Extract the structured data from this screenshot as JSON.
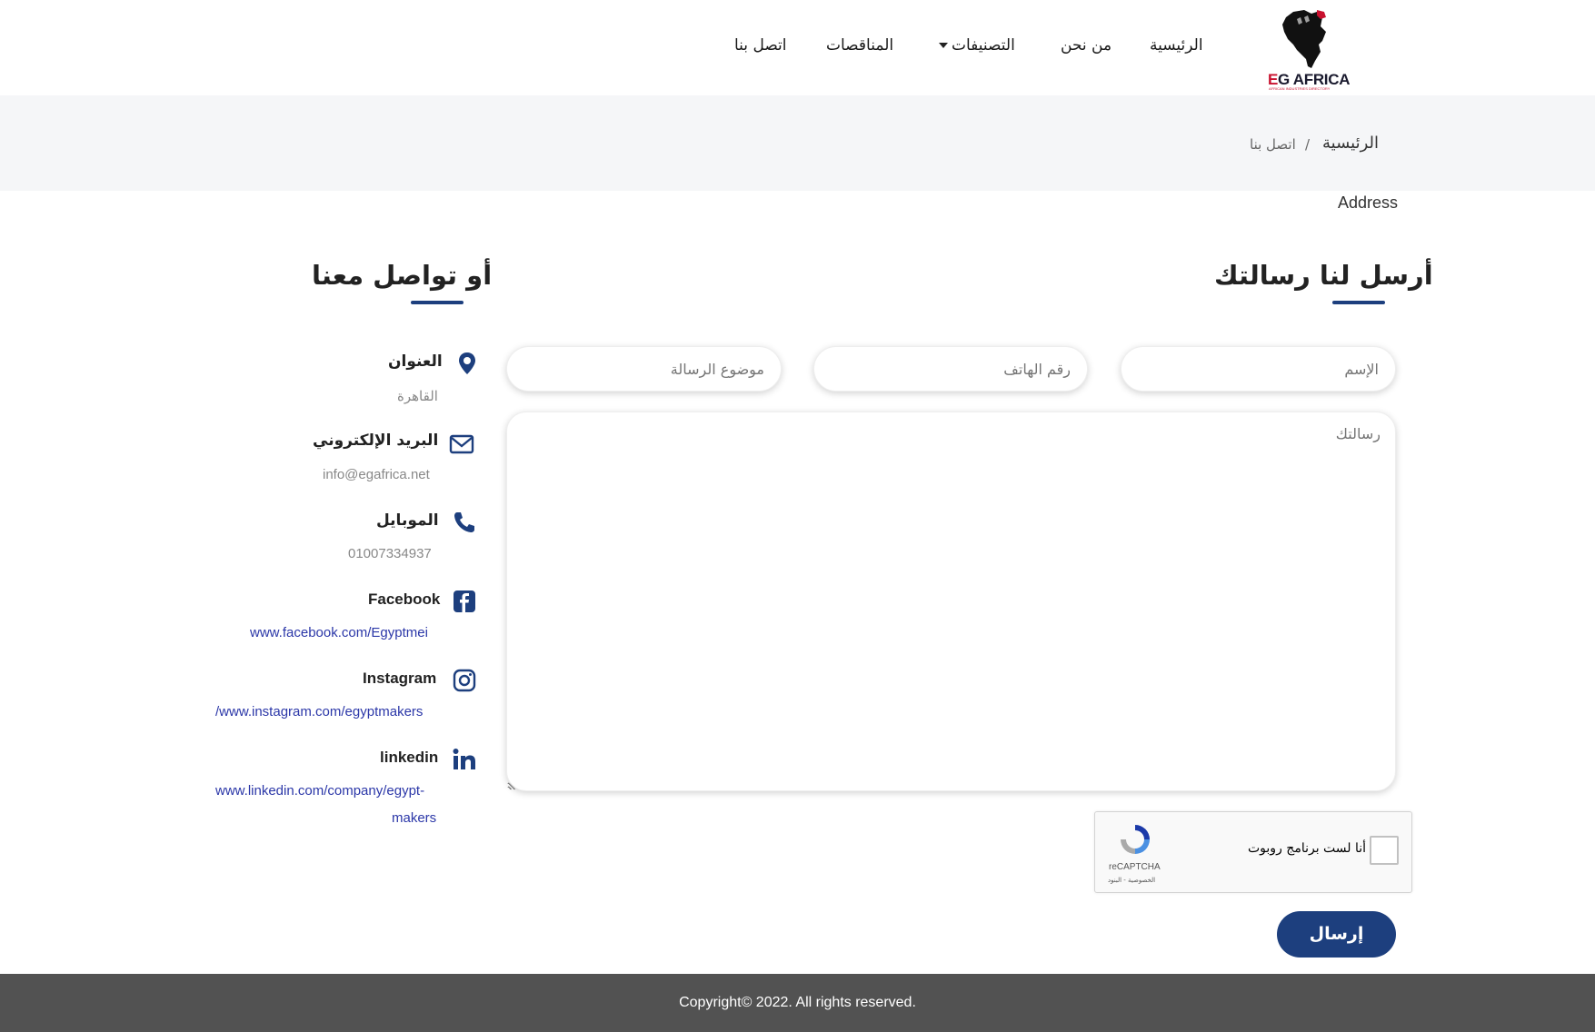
{
  "header": {
    "logo_text_e": "E",
    "logo_text_rest": "G AFRICA",
    "logo_sub": "AFRICAN INDUSTRIES DIRECTORY",
    "nav": {
      "home": "الرئيسية",
      "about": "من نحن",
      "categories": "التصنيفات",
      "tenders": "المناقصات",
      "contact": "اتصل بنا"
    }
  },
  "breadcrumb": {
    "home": "الرئيسية",
    "separator": "/",
    "current": "اتصل بنا"
  },
  "address_label": "Address",
  "form": {
    "title": "أرسل لنا رسالتك",
    "name_placeholder": "الإسم",
    "phone_placeholder": "رقم الهاتف",
    "subject_placeholder": "موضوع الرسالة",
    "message_placeholder": "رسالتك",
    "captcha": {
      "label": "أنا لست برنامج روبوت",
      "brand": "reCAPTCHA",
      "links": "الخصوصية - البنود"
    },
    "submit": "إرسال"
  },
  "contact": {
    "title": "أو تواصل معنا",
    "address_label": "العنوان",
    "address_value": "القاهرة",
    "email_label": "البريد الإلكتروني",
    "email_value": "info@egafrica.net",
    "mobile_label": "الموبايل",
    "mobile_value": "01007334937",
    "facebook_label": "Facebook",
    "facebook_value": "www.facebook.com/Egyptmei",
    "instagram_label": "Instagram",
    "instagram_value": "/www.instagram.com/egyptmakers",
    "linkedin_label": "linkedin",
    "linkedin_value_1": "www.linkedin.com/company/egypt-",
    "linkedin_value_2": "makers"
  },
  "footer": {
    "copyright": "Copyright© 2022. All rights reserved."
  },
  "colors": {
    "primary": "#1d3f7e",
    "link": "#2b37a8",
    "footer_bg": "#525252",
    "band_bg": "#f5f6f8",
    "logo_red": "#c8102e"
  },
  "icons": [
    "fist-africa-logo",
    "map-pin-icon",
    "envelope-icon",
    "phone-icon",
    "facebook-icon",
    "instagram-icon",
    "linkedin-icon",
    "recaptcha-icon",
    "caret-down-icon"
  ]
}
